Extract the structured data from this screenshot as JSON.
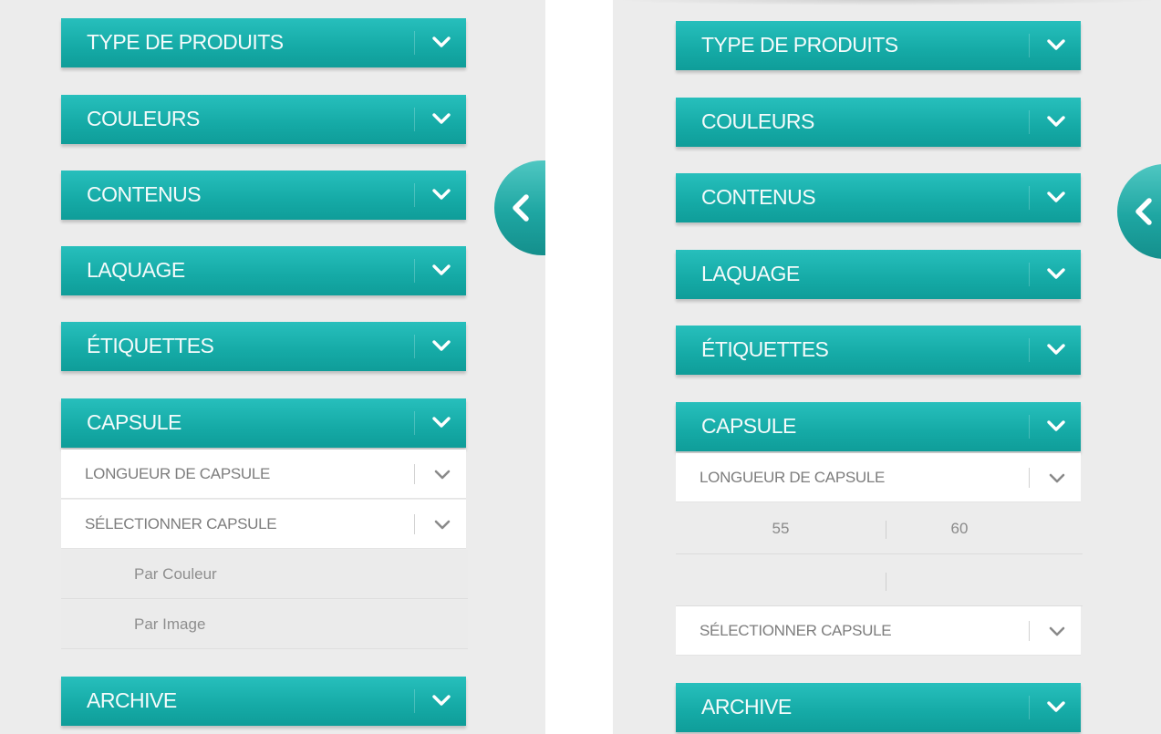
{
  "left_panel": {
    "sections": [
      {
        "label": "TYPE DE PRODUITS"
      },
      {
        "label": "COULEURS"
      },
      {
        "label": "CONTENUS"
      },
      {
        "label": "LAQUAGE"
      },
      {
        "label": "ÉTIQUETTES"
      },
      {
        "label": "CAPSULE"
      }
    ],
    "capsule_sub": [
      {
        "label": "LONGUEUR DE CAPSULE"
      },
      {
        "label": "SÉLECTIONNER CAPSULE"
      }
    ],
    "select_options": [
      {
        "label": "Par Couleur"
      },
      {
        "label": "Par Image"
      }
    ],
    "archive": {
      "label": "ARCHIVE"
    }
  },
  "right_panel": {
    "sections": [
      {
        "label": "TYPE DE PRODUITS"
      },
      {
        "label": "COULEURS"
      },
      {
        "label": "CONTENUS"
      },
      {
        "label": "LAQUAGE"
      },
      {
        "label": "ÉTIQUETTES"
      },
      {
        "label": "CAPSULE"
      }
    ],
    "capsule_length": {
      "label": "LONGUEUR DE CAPSULE",
      "values": [
        "55",
        "60"
      ]
    },
    "capsule_select": {
      "label": "SÉLECTIONNER CAPSULE"
    },
    "archive": {
      "label": "ARCHIVE"
    }
  },
  "colors": {
    "accent": "#17aca8",
    "background": "#ececec"
  },
  "icons": {
    "expand": "chevron-down-icon",
    "collapse_panel": "chevron-left-icon"
  }
}
